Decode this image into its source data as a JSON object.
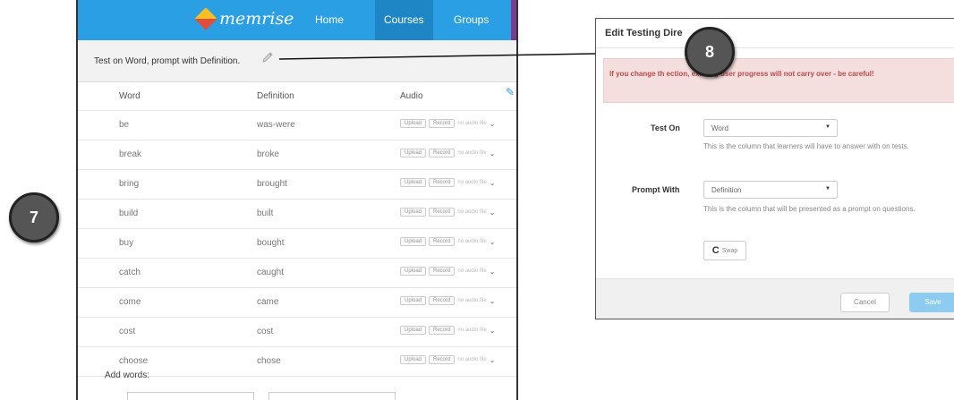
{
  "callouts": {
    "step7": "7",
    "step8": "8"
  },
  "header": {
    "brand": "memrise",
    "nav": [
      "Home",
      "Courses",
      "Groups"
    ]
  },
  "course": {
    "settings_text": "Test on Word, prompt with Definition."
  },
  "table": {
    "columns": [
      "Word",
      "Definition",
      "Audio"
    ],
    "audio_controls": {
      "upload": "Upload",
      "record": "Record",
      "nofile": "no audio file"
    },
    "rows": [
      [
        "be",
        "was-were"
      ],
      [
        "break",
        "broke"
      ],
      [
        "bring",
        "brought"
      ],
      [
        "build",
        "built"
      ],
      [
        "buy",
        "bought"
      ],
      [
        "catch",
        "caught"
      ],
      [
        "come",
        "came"
      ],
      [
        "cost",
        "cost"
      ],
      [
        "choose",
        "chose"
      ]
    ],
    "add_words": "Add words:"
  },
  "dialog": {
    "title": "Edit Testing Dire",
    "alert": "If you change th                    ection, existing user progress will not carry over - be careful!",
    "test_on": {
      "label": "Test On",
      "value": "Word",
      "help": "This is the column that learners will have to answer with on tests."
    },
    "prompt_with": {
      "label": "Prompt With",
      "value": "Definition",
      "help": "This is the column that will be presented as a prompt on questions."
    },
    "swap": "Swap",
    "cancel": "Cancel",
    "save": "Save"
  },
  "colors": {
    "nav_bg": "#2a9fe3",
    "alert_bg": "#f4dede",
    "alert_text": "#b94a48",
    "save_bg": "#8ecbf0",
    "callout_bg": "#555555"
  }
}
